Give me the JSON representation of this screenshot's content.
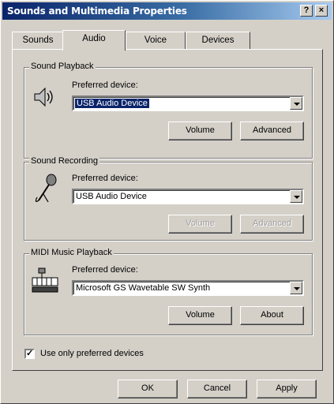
{
  "window": {
    "title": "Sounds and Multimedia Properties",
    "help_label": "?",
    "close_label": "×"
  },
  "tabs": [
    {
      "label": "Sounds",
      "active": false
    },
    {
      "label": "Audio",
      "active": true
    },
    {
      "label": "Voice",
      "active": false
    },
    {
      "label": "Devices",
      "active": false
    }
  ],
  "playback": {
    "group_label": "Sound Playback",
    "preferred_label": "Preferred device:",
    "device": "USB Audio Device",
    "volume_label": "Volume",
    "advanced_label": "Advanced",
    "icon": "speaker-icon"
  },
  "recording": {
    "group_label": "Sound Recording",
    "preferred_label": "Preferred device:",
    "device": "USB Audio Device",
    "volume_label": "Volume",
    "advanced_label": "Advanced",
    "icon": "microphone-icon"
  },
  "midi": {
    "group_label": "MIDI Music Playback",
    "preferred_label": "Preferred device:",
    "device": "Microsoft GS Wavetable SW Synth",
    "volume_label": "Volume",
    "about_label": "About",
    "icon": "midi-keyboard-icon"
  },
  "use_preferred": {
    "label": "Use only preferred devices",
    "checked": true
  },
  "footer": {
    "ok_label": "OK",
    "cancel_label": "Cancel",
    "apply_label": "Apply"
  }
}
